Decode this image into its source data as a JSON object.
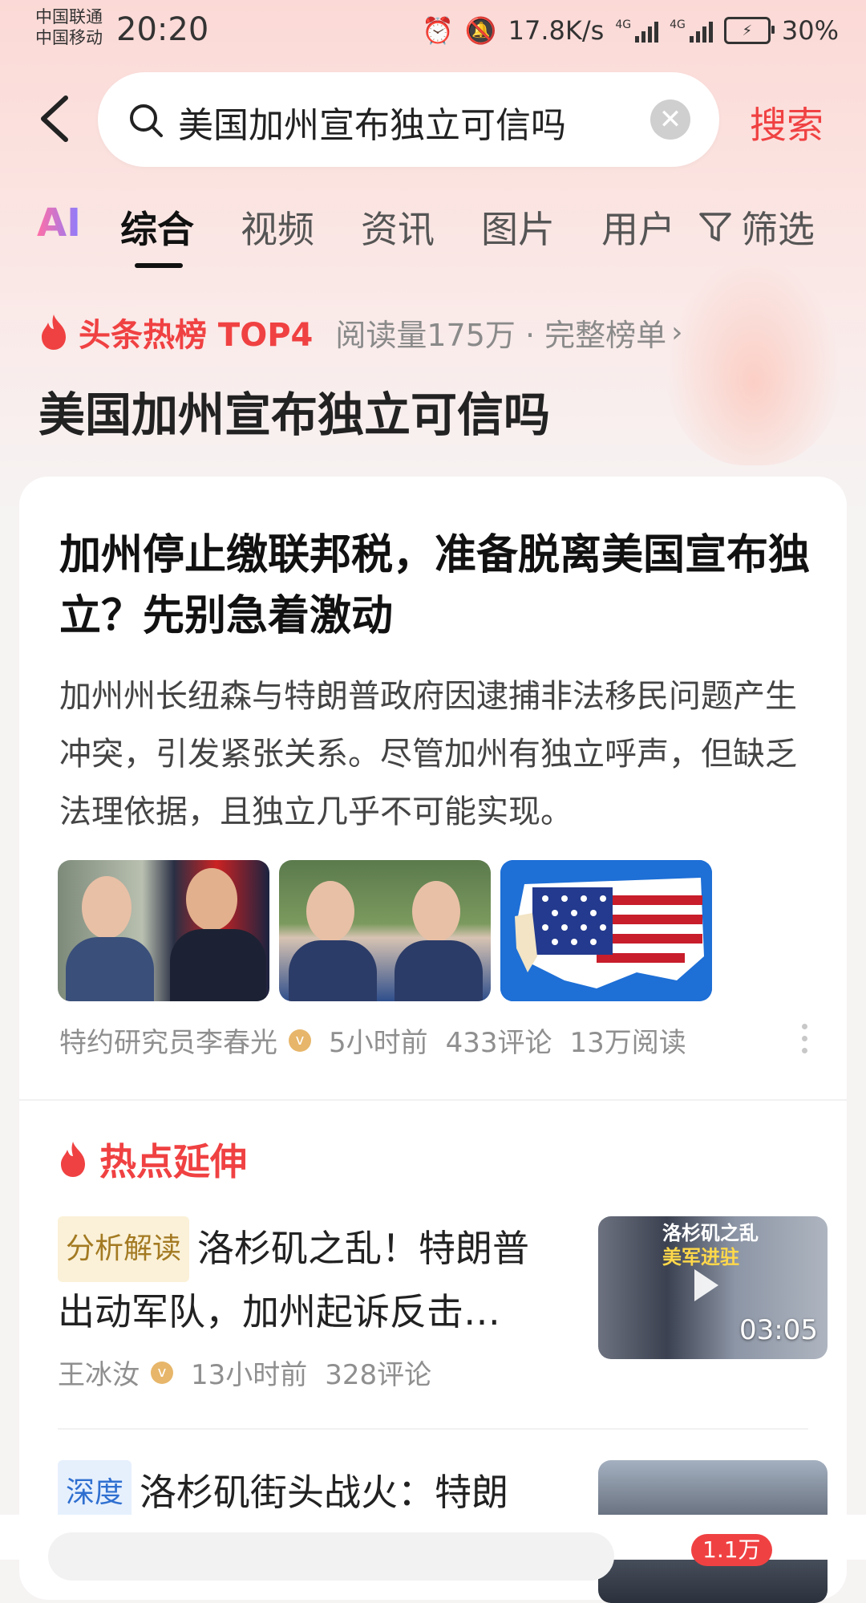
{
  "status_bar": {
    "carrier_1": "中国联通",
    "carrier_2": "中国移动",
    "time": "20:20",
    "speed": "17.8K/s",
    "net_1": "4G",
    "net_2": "4G",
    "battery": "30%",
    "icons": [
      "alarm-icon",
      "mute-icon",
      "signal-icon",
      "battery-icon"
    ]
  },
  "search": {
    "query": "美国加州宣布独立可信吗",
    "button": "搜索"
  },
  "tabs": [
    "AI",
    "综合",
    "视频",
    "资讯",
    "图片",
    "用户"
  ],
  "active_tab": "综合",
  "filter_label": "筛选",
  "hot": {
    "rank_label": "头条热榜 TOP4",
    "meta": "阅读量175万 · 完整榜单",
    "title": "美国加州宣布独立可信吗"
  },
  "article": {
    "title": "加州停止缴联邦税，准备脱离美国宣布独立？先别急着激动",
    "abstract": "加州州长纽森与特朗普政府因逮捕非法移民问题产生冲突，引发紧张关系。尽管加州有独立呼声，但缺乏法理依据，且独立几乎不可能实现。",
    "author": "特约研究员李春光",
    "time": "5小时前",
    "comments": "433评论",
    "reads": "13万阅读"
  },
  "extension": {
    "heading": "热点延伸",
    "items": [
      {
        "tag": "分析解读",
        "title": "洛杉矶之乱！特朗普出动军队，加州起诉反击…",
        "author": "王冰汝",
        "time": "13小时前",
        "comments": "328评论",
        "duration": "03:05",
        "overlay_1": "洛杉矶之乱",
        "overlay_2": "美军进驻"
      },
      {
        "tag": "深度",
        "title": "洛杉矶街头战火：特朗"
      }
    ]
  },
  "bottom": {
    "badge": "1.1万"
  },
  "colors": {
    "accent": "#f04142",
    "tag_yellow_bg": "#fbf1d8",
    "tag_blue_bg": "#e6f0fd"
  }
}
